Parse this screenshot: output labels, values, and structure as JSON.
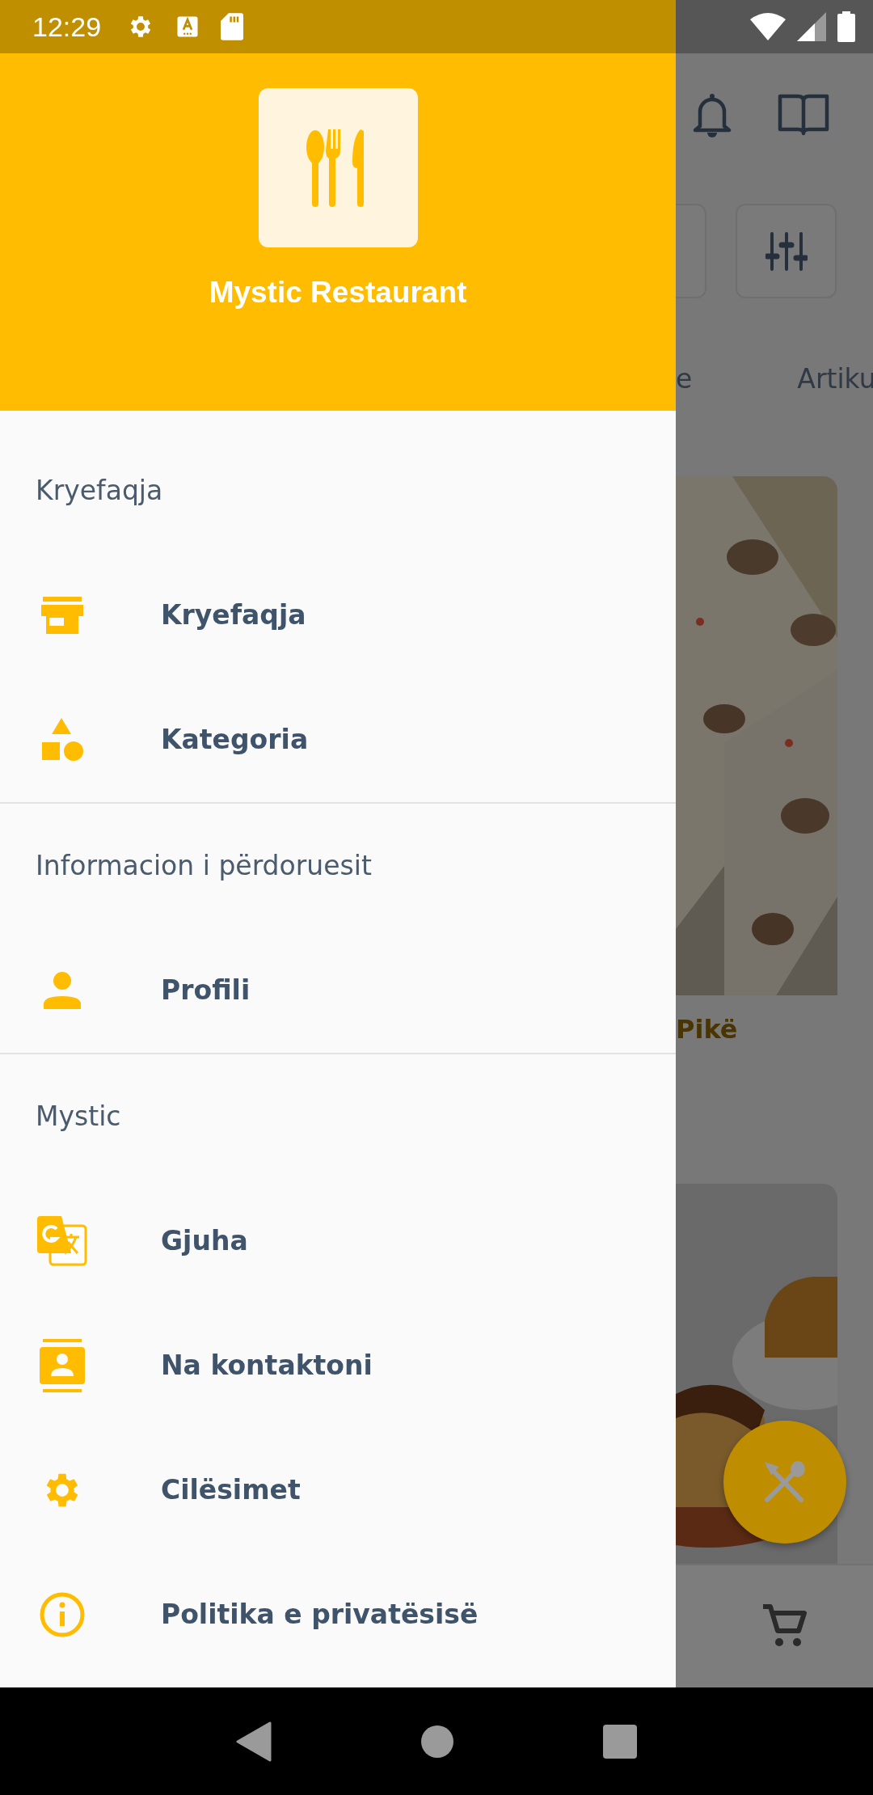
{
  "status_bar": {
    "time": "12:29"
  },
  "drawer": {
    "title": "Mystic Restaurant",
    "sections": [
      {
        "header": "Kryefaqja",
        "items": [
          {
            "label": "Kryefaqja"
          },
          {
            "label": "Kategoria"
          }
        ]
      },
      {
        "header": "Informacion i përdoruesit",
        "items": [
          {
            "label": "Profili"
          }
        ]
      },
      {
        "header": "Mystic",
        "items": [
          {
            "label": "Gjuha"
          },
          {
            "label": "Na kontaktoni"
          },
          {
            "label": "Cilësimet"
          },
          {
            "label": "Politika e privatësisë"
          }
        ]
      }
    ]
  },
  "background": {
    "tabs": [
      "e",
      "Artiku"
    ],
    "card_title": "Pikë"
  }
}
